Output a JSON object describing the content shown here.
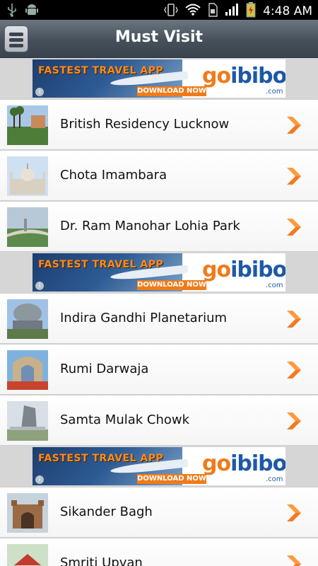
{
  "status_bar": {
    "time": "4:48 AM",
    "icons": [
      "usb-icon",
      "android-icon",
      "vibrate-icon",
      "wifi-icon",
      "sim-icon",
      "signal-icon",
      "battery-charging-icon"
    ]
  },
  "header": {
    "title": "Must Visit",
    "menu_icon": "menu-icon"
  },
  "ad": {
    "headline": "FASTEST TRAVEL APP",
    "cta": "DOWNLOAD NOW",
    "brand_go": "go",
    "brand_ibibo": "ibibo",
    "domain": ".com",
    "info": "i"
  },
  "places": [
    {
      "name": "British Residency Lucknow",
      "thumb_colors": [
        "#a9c7e6",
        "#4e7d3a"
      ]
    },
    {
      "name": "Chota Imambara",
      "thumb_colors": [
        "#cfe0f2",
        "#d8d0c0"
      ]
    },
    {
      "name": "Dr. Ram Manohar Lohia Park",
      "thumb_colors": [
        "#b7c9d6",
        "#5e8a4d"
      ]
    },
    {
      "name": "Indira Gandhi Planetarium",
      "thumb_colors": [
        "#9fc1e4",
        "#7f8c93"
      ]
    },
    {
      "name": "Rumi Darwaja",
      "thumb_colors": [
        "#7fb1df",
        "#c9432e"
      ]
    },
    {
      "name": "Samta Mulak Chowk",
      "thumb_colors": [
        "#d8dfe6",
        "#8da27c"
      ]
    },
    {
      "name": "Sikander Bagh",
      "thumb_colors": [
        "#c6d2dc",
        "#9a6b45"
      ]
    },
    {
      "name": "Smriti Upvan",
      "thumb_colors": [
        "#cde0c8",
        "#c23b2f"
      ]
    }
  ],
  "colors": {
    "chevron": "#f47a20",
    "title_bar": "#45505b"
  }
}
